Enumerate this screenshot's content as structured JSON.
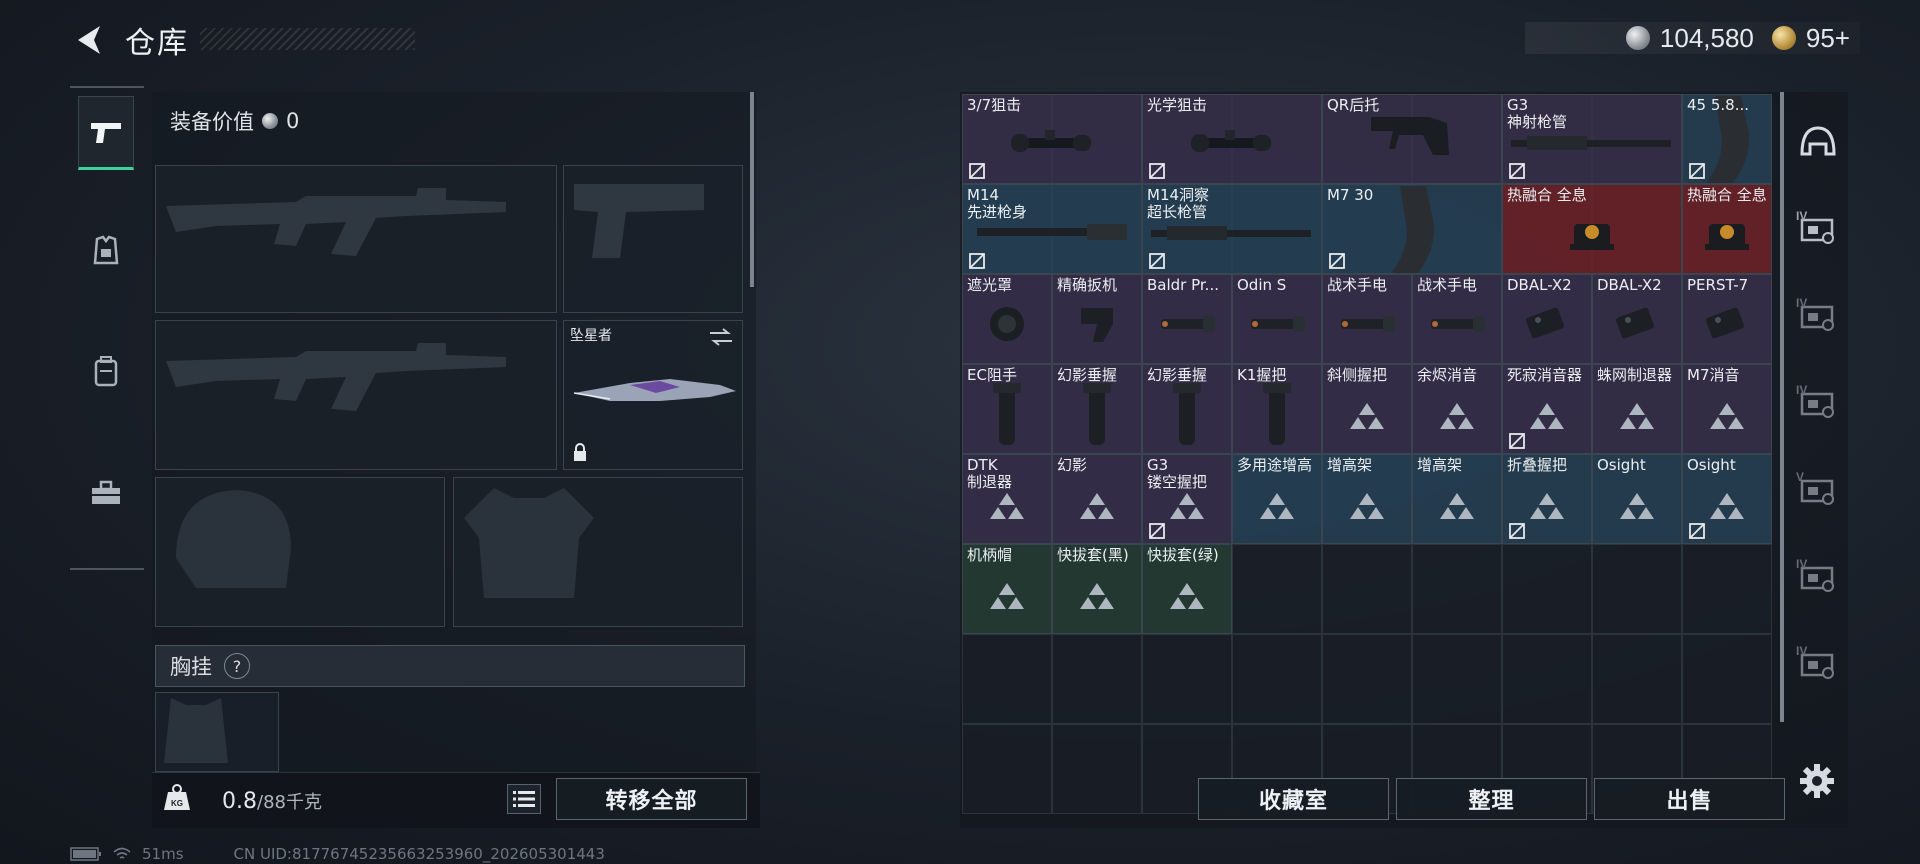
{
  "header": {
    "title": "仓库",
    "silver_amount": "104,580",
    "gold_amount": "95+"
  },
  "left_tabs": [
    {
      "icon": "pistol-icon",
      "active": true
    },
    {
      "icon": "armor-icon",
      "active": false
    },
    {
      "icon": "backpack-icon",
      "active": false
    },
    {
      "icon": "toolbox-icon",
      "active": false
    }
  ],
  "equipment": {
    "value_label": "装备价值",
    "value": "0",
    "melee_name": "坠星者",
    "chest_label": "胸挂",
    "chest_help": "?"
  },
  "weight": {
    "current": "0.8",
    "capacity": "/88千克"
  },
  "buttons": {
    "transfer_all": "转移全部",
    "collection": "收藏室",
    "organize": "整理",
    "sell": "出售"
  },
  "status": {
    "ping": "51ms",
    "uid": "CN UID:81776745235663253960_202605301443"
  },
  "colors": {
    "accent": "#3ecf9a",
    "blue": "#28465c",
    "purple": "#3a304e",
    "red": "#6e2228",
    "green": "#243e34"
  },
  "grid_items": [
    {
      "label": "3/7狙击",
      "rarity": "purple",
      "icon": "scope-icon",
      "unbindable": true
    },
    {
      "label": "光学狙击",
      "rarity": "purple",
      "icon": "scope-icon",
      "unbindable": true
    },
    {
      "label": "QR后托",
      "rarity": "purple",
      "icon": "stock-icon",
      "unbindable": false
    },
    {
      "label": "G3\n神射枪管",
      "rarity": "purple",
      "icon": "barrel-icon",
      "unbindable": true
    },
    {
      "label": "45 5.8...",
      "rarity": "blue",
      "icon": "magazine-icon",
      "unbindable": true
    },
    {
      "label": "M14\n先进枪身",
      "rarity": "blue",
      "icon": "handguard-icon",
      "unbindable": true
    },
    {
      "label": "M14洞察\n超长枪管",
      "rarity": "blue",
      "icon": "barrel-icon",
      "unbindable": true
    },
    {
      "label": "M7 30",
      "rarity": "blue",
      "icon": "magazine-icon",
      "unbindable": true
    },
    {
      "label": "热融合 全息",
      "rarity": "red",
      "icon": "holo-sight-icon",
      "unbindable": false
    },
    {
      "label": "热融合 全息",
      "rarity": "red",
      "icon": "holo-sight-icon",
      "unbindable": false
    },
    {
      "label": "遮光罩",
      "rarity": "purple",
      "icon": "lens-hood-icon",
      "unbindable": false
    },
    {
      "label": "精确扳机",
      "rarity": "purple",
      "icon": "trigger-icon",
      "unbindable": false
    },
    {
      "label": "Baldr Pr...",
      "rarity": "purple",
      "icon": "flashlight-icon",
      "unbindable": false
    },
    {
      "label": "Odin S",
      "rarity": "purple",
      "icon": "flashlight-icon",
      "unbindable": false
    },
    {
      "label": "战术手电",
      "rarity": "purple",
      "icon": "flashlight-icon",
      "unbindable": false
    },
    {
      "label": "战术手电",
      "rarity": "purple",
      "icon": "flashlight-icon",
      "unbindable": false
    },
    {
      "label": "DBAL-X2",
      "rarity": "purple",
      "icon": "laser-icon",
      "unbindable": false
    },
    {
      "label": "DBAL-X2",
      "rarity": "purple",
      "icon": "laser-icon",
      "unbindable": false
    },
    {
      "label": "PERST-7",
      "rarity": "purple",
      "icon": "laser-icon",
      "unbindable": false
    },
    {
      "label": "EC阻手",
      "rarity": "purple",
      "icon": "grip-icon",
      "unbindable": false
    },
    {
      "label": "幻影垂握",
      "rarity": "purple",
      "icon": "grip-icon",
      "unbindable": false
    },
    {
      "label": "幻影垂握",
      "rarity": "purple",
      "icon": "grip-icon",
      "unbindable": false
    },
    {
      "label": "K1握把",
      "rarity": "purple",
      "icon": "grip-icon",
      "unbindable": false
    },
    {
      "label": "斜侧握把",
      "rarity": "purple",
      "icon": "placeholder-triangle-icon",
      "unbindable": false
    },
    {
      "label": "余烬消音",
      "rarity": "purple",
      "icon": "placeholder-triangle-icon",
      "unbindable": false
    },
    {
      "label": "死寂消音器",
      "rarity": "purple",
      "icon": "placeholder-triangle-icon",
      "unbindable": true
    },
    {
      "label": "蛛网制退器",
      "rarity": "purple",
      "icon": "placeholder-triangle-icon",
      "unbindable": false
    },
    {
      "label": "M7消音",
      "rarity": "purple",
      "icon": "placeholder-triangle-icon",
      "unbindable": false
    },
    {
      "label": "DTK\n制退器",
      "rarity": "purple",
      "icon": "placeholder-triangle-icon",
      "unbindable": false
    },
    {
      "label": "幻影",
      "rarity": "purple",
      "icon": "placeholder-triangle-icon",
      "unbindable": false
    },
    {
      "label": "G3\n镂空握把",
      "rarity": "purple",
      "icon": "placeholder-triangle-icon",
      "unbindable": true
    },
    {
      "label": "多用途增高",
      "rarity": "blue",
      "icon": "placeholder-triangle-icon",
      "unbindable": false
    },
    {
      "label": "增高架",
      "rarity": "blue",
      "icon": "placeholder-triangle-icon",
      "unbindable": false
    },
    {
      "label": "增高架",
      "rarity": "blue",
      "icon": "placeholder-triangle-icon",
      "unbindable": false
    },
    {
      "label": "折叠握把",
      "rarity": "blue",
      "icon": "placeholder-triangle-icon",
      "unbindable": true
    },
    {
      "label": "Osight",
      "rarity": "blue",
      "icon": "placeholder-triangle-icon",
      "unbindable": false
    },
    {
      "label": "Osight",
      "rarity": "blue",
      "icon": "placeholder-triangle-icon",
      "unbindable": true
    },
    {
      "label": "机柄帽",
      "rarity": "green",
      "icon": "placeholder-triangle-icon",
      "unbindable": false
    },
    {
      "label": "快拔套(黑)",
      "rarity": "green",
      "icon": "placeholder-triangle-icon",
      "unbindable": false
    },
    {
      "label": "快拔套(绿)",
      "rarity": "green",
      "icon": "placeholder-triangle-icon",
      "unbindable": false
    }
  ],
  "right_tabs": [
    {
      "icon": "helmet-category-icon",
      "level": ""
    },
    {
      "icon": "attachment-category-icon",
      "level": "IV"
    },
    {
      "icon": "ammo-category-icon",
      "level": "IV"
    },
    {
      "icon": "medical-category-icon",
      "level": "IV"
    },
    {
      "icon": "key-category-icon",
      "level": "V"
    },
    {
      "icon": "keycard-category-icon",
      "level": "IV"
    },
    {
      "icon": "misc-category-icon",
      "level": "IV"
    }
  ]
}
